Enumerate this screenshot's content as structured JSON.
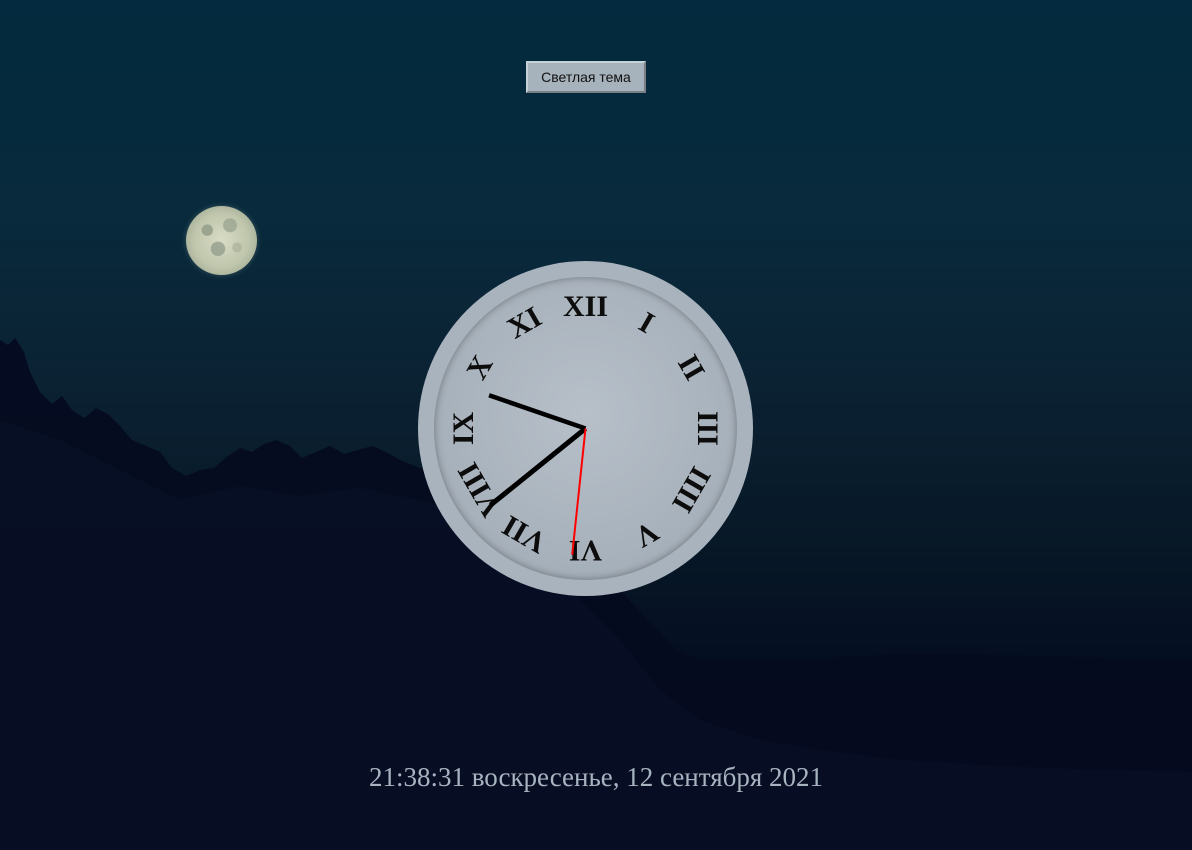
{
  "theme_toggle": {
    "label": "Светлая тема"
  },
  "clock": {
    "numerals": [
      "XII",
      "I",
      "II",
      "III",
      "IIII",
      "V",
      "VI",
      "VII",
      "VIII",
      "IX",
      "X",
      "XI"
    ],
    "time": {
      "hours": 21,
      "minutes": 38,
      "seconds": 31
    },
    "colors": {
      "hands": "#000000",
      "second_hand": "#ff0000",
      "face": "#a6b0ba",
      "ring": "#a9b3bd"
    }
  },
  "footer": {
    "datetime_text": "21:38:31 воскресенье, 12 сентября 2021"
  },
  "icons": {
    "moon": "moon-icon",
    "background": "night-landscape"
  }
}
